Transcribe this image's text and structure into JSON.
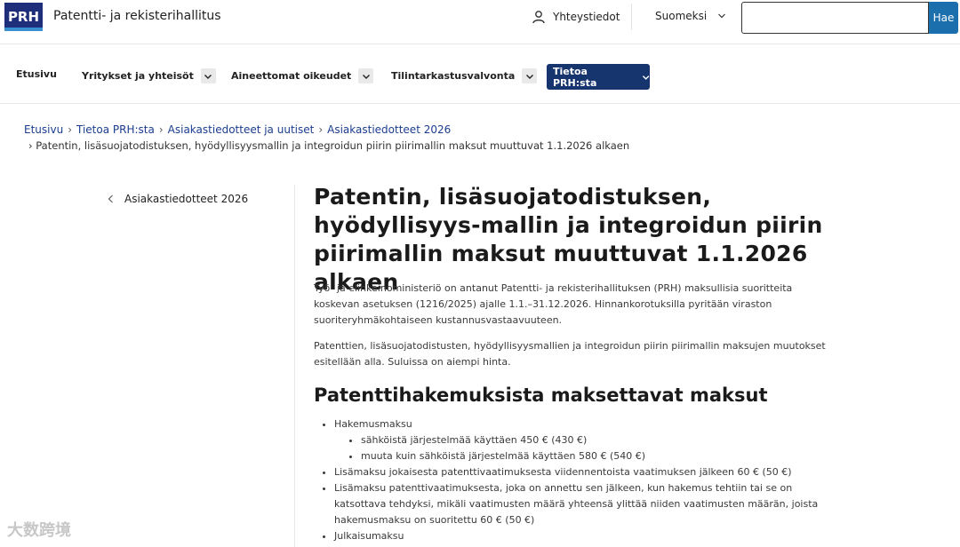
{
  "header": {
    "logo_text": "PRH",
    "site_name": "Patentti- ja rekisterihallitus",
    "contact_label": "Yhteystiedot",
    "language": "Suomeksi",
    "search_placeholder": "",
    "search_button": "Hae"
  },
  "nav": {
    "items": [
      {
        "label": "Etusivu"
      },
      {
        "label": "Yritykset ja yhteisöt"
      },
      {
        "label": "Aineettomat oikeudet"
      },
      {
        "label": "Tilintarkastusvalvonta"
      },
      {
        "label": "Tietoa PRH:sta"
      }
    ]
  },
  "breadcrumb": {
    "items": [
      "Etusivu",
      "Tietoa PRH:sta",
      "Asiakastiedotteet ja uutiset",
      "Asiakastiedotteet 2026"
    ],
    "current": "Patentin, lisäsuojatodistuksen, hyödyllisyysmallin ja integroidun piirin piirimallin maksut muuttuvat 1.1.2026 alkaen"
  },
  "sidebar": {
    "back_label": "Asiakastiedotteet 2026"
  },
  "article": {
    "title": "Patentin, lisäsuojatodistuksen, hyödyllisyys-mallin ja integroidun piirin piirimallin maksut muuttuvat 1.1.2026 alkaen",
    "para1": "Työ- ja elinkeinoministeriö on antanut Patentti- ja rekisterihallituksen (PRH) maksullisia suoritteita koskevan asetuksen (1216/2025) ajalle 1.1.–31.12.2026. Hinnankorotuksilla pyritään viraston suoriteryhmäkohtaiseen kustannusvastaavuuteen.",
    "para2": "Patenttien, lisäsuojatodistusten, hyödyllisyysmallien ja integroidun piirin piirimallin maksujen muutokset esitellään alla. Suluissa on aiempi hinta.",
    "section_heading": "Patenttihakemuksista maksettavat maksut",
    "fees": {
      "item1": "Hakemusmaksu",
      "item1_sub1": "sähköistä järjestelmää käyttäen 450 € (430 €)",
      "item1_sub2": "muuta kuin sähköistä järjestelmää käyttäen 580 € (540 €)",
      "item2": "Lisämaksu jokaisesta patenttivaatimuksesta viidennentoista vaatimuksen jälkeen 60 € (50 €)",
      "item3": "Lisämaksu patenttivaatimuksesta, joka on annettu sen jälkeen, kun hakemus tehtiin tai se on katsottava tehdyksi, mikäli vaatimusten määrä yhteensä ylittää niiden vaatimusten määrän, joista hakemusmaksu on suoritettu 60 € (50 €)",
      "item4": "Julkaisumaksu"
    }
  },
  "watermark": "大数跨境",
  "colors": {
    "brand_navy": "#16356e",
    "search_button": "#1b6fad",
    "link": "#1b3d8f"
  }
}
